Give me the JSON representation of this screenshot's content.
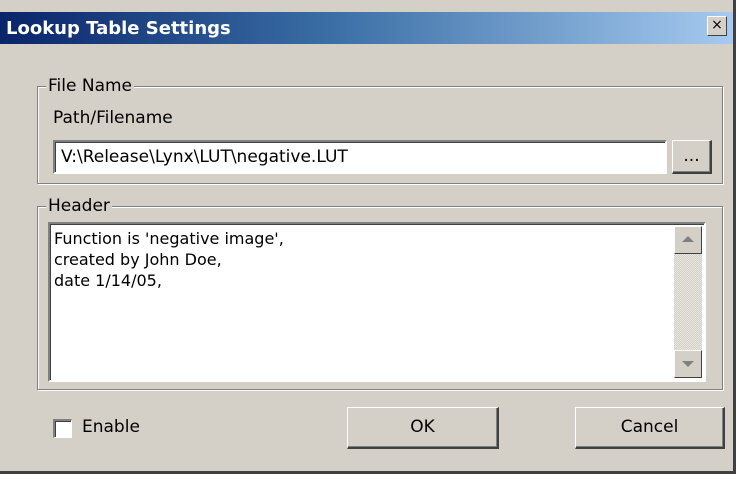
{
  "window": {
    "title": "Lookup Table Settings",
    "close_glyph": "×"
  },
  "file_group": {
    "label": "File Name",
    "path_label": "Path/Filename",
    "path_value": "V:\\Release\\Lynx\\LUT\\negative.LUT",
    "browse_label": "..."
  },
  "header_group": {
    "label": "Header",
    "lines": [
      "Function is 'negative image',",
      "created by  John Doe,",
      "date 1/14/05,"
    ]
  },
  "footer": {
    "enable_label": "Enable",
    "enable_checked": false,
    "ok_label": "OK",
    "cancel_label": "Cancel"
  },
  "colors": {
    "dialog_bg": "#d4d0c8",
    "titlebar_start": "#0a246a",
    "titlebar_end": "#a6caf0"
  }
}
